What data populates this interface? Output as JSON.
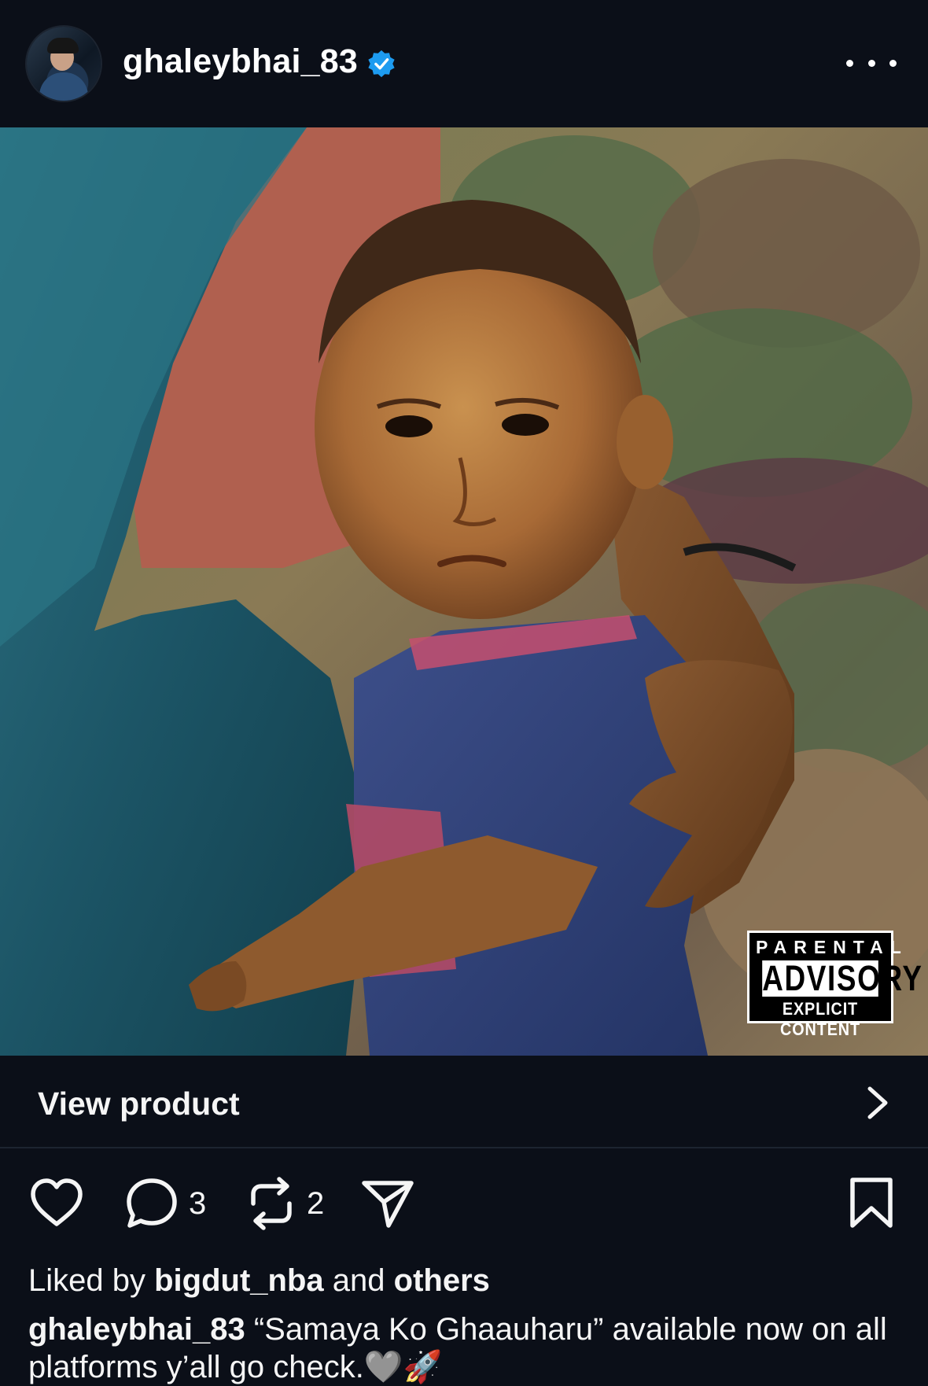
{
  "post": {
    "username": "ghaleybhai_83",
    "verified_icon": "verified-badge-icon",
    "more_icon": "more-options-icon"
  },
  "image": {
    "description_icon": "album-cover-photo",
    "advisory": {
      "line1": "PARENTAL",
      "line2": "ADVISORY",
      "line3": "EXPLICIT CONTENT"
    }
  },
  "product": {
    "label": "View product"
  },
  "actions": {
    "like_icon": "heart-icon",
    "comment_count": "3",
    "repost_count": "2",
    "share_icon": "send-icon",
    "save_icon": "bookmark-icon"
  },
  "likes": {
    "prefix": "Liked by",
    "user": "bigdut_nba",
    "connector": "and",
    "others": "others"
  },
  "caption": {
    "username": "ghaleybhai_83",
    "text": "“Samaya Ko Ghaauharu” available now on all platforms y’all go check.🩶🚀"
  },
  "colors": {
    "background": "#0b0f18",
    "verified": "#1d9bf0",
    "text": "#f5f5f5"
  }
}
